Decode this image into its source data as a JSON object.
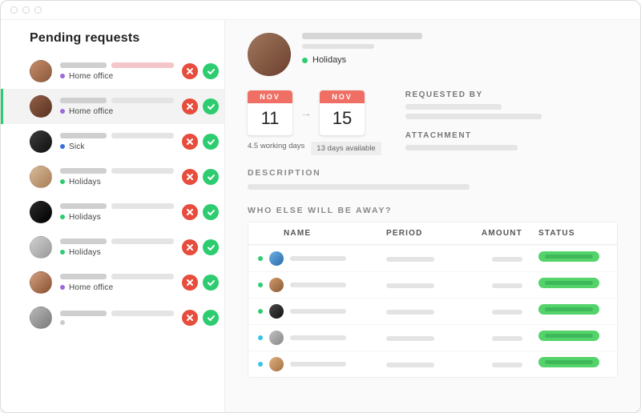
{
  "sidebar": {
    "title": "Pending requests",
    "items": [
      {
        "type_label": "Home office",
        "type_color": "#9b6bd8",
        "selected": false,
        "bar_tone": "red",
        "avatar_gradient": [
          "#c58b68",
          "#8a5a3e"
        ]
      },
      {
        "type_label": "Home office",
        "type_color": "#9b6bd8",
        "selected": true,
        "bar_tone": "gray",
        "avatar_gradient": [
          "#905f45",
          "#5b3223"
        ]
      },
      {
        "type_label": "Sick",
        "type_color": "#3b6fdc",
        "selected": false,
        "bar_tone": "gray",
        "avatar_gradient": [
          "#3b3b3b",
          "#111"
        ]
      },
      {
        "type_label": "Holidays",
        "type_color": "#2ecc71",
        "selected": false,
        "bar_tone": "gray",
        "avatar_gradient": [
          "#d8b999",
          "#a97f58"
        ]
      },
      {
        "type_label": "Holidays",
        "type_color": "#2ecc71",
        "selected": false,
        "bar_tone": "gray",
        "avatar_gradient": [
          "#2a2a2a",
          "#000"
        ]
      },
      {
        "type_label": "Holidays",
        "type_color": "#2ecc71",
        "selected": false,
        "bar_tone": "gray",
        "avatar_gradient": [
          "#cfcfcf",
          "#9a9a9a"
        ]
      },
      {
        "type_label": "Home office",
        "type_color": "#9b6bd8",
        "selected": false,
        "bar_tone": "gray",
        "avatar_gradient": [
          "#d0a080",
          "#8a5030"
        ]
      },
      {
        "type_label": "",
        "type_color": "#cccccc",
        "selected": false,
        "bar_tone": "gray",
        "avatar_gradient": [
          "#b8b8b8",
          "#7a7a7a"
        ]
      }
    ]
  },
  "detail": {
    "tag_label": "Holidays",
    "tag_color": "#2ecc71",
    "date_from": {
      "month": "NOV",
      "day": "11"
    },
    "date_to": {
      "month": "NOV",
      "day": "15"
    },
    "working_days_text": "4.5 working days",
    "available_text": "13 days available",
    "labels": {
      "requested_by": "REQUESTED BY",
      "attachment": "ATTACHMENT",
      "description": "DESCRIPTION",
      "who_else": "WHO ELSE WILL BE AWAY?"
    },
    "table": {
      "columns": {
        "name": "NAME",
        "period": "PERIOD",
        "amount": "AMOUNT",
        "status": "STATUS"
      },
      "rows": [
        {
          "dot_color": "#2ecc71",
          "avatar_gradient": [
            "#6fb1e6",
            "#2a6aa8"
          ]
        },
        {
          "dot_color": "#2ecc71",
          "avatar_gradient": [
            "#d39a6a",
            "#8a5a34"
          ]
        },
        {
          "dot_color": "#2ecc71",
          "avatar_gradient": [
            "#4a4a4a",
            "#111"
          ]
        },
        {
          "dot_color": "#38c1e6",
          "avatar_gradient": [
            "#c0c0c0",
            "#888"
          ]
        },
        {
          "dot_color": "#38c1e6",
          "avatar_gradient": [
            "#e0b080",
            "#a57040"
          ]
        }
      ]
    }
  }
}
